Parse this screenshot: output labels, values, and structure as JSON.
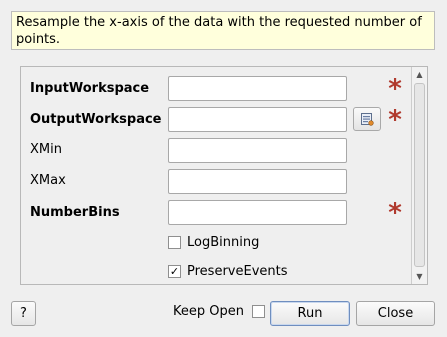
{
  "description": "Resample the x-axis of the data with the requested number of points.",
  "properties": [
    {
      "label": "InputWorkspace",
      "value": "",
      "required": true,
      "bold": true
    },
    {
      "label": "OutputWorkspace",
      "value": "",
      "required": true,
      "bold": true
    },
    {
      "label": "XMin",
      "value": "",
      "required": false,
      "bold": false
    },
    {
      "label": "XMax",
      "value": "",
      "required": false,
      "bold": false
    },
    {
      "label": "NumberBins",
      "value": "",
      "required": true,
      "bold": true
    }
  ],
  "required_marker": "*",
  "checkboxes": [
    {
      "label": "LogBinning",
      "checked": false,
      "check_mark": ""
    },
    {
      "label": "PreserveEvents",
      "checked": true,
      "check_mark": "✓"
    }
  ],
  "footer": {
    "help_label": "?",
    "keep_open_label": "Keep Open",
    "keep_open_checked": false,
    "run_label": "Run",
    "close_label": "Close"
  },
  "icons": {
    "browse": "workspace-browse-icon",
    "scroll_up": "▲",
    "scroll_down": "▼"
  },
  "colors": {
    "description_bg": "#ffffdc",
    "required_star": "#b03a2e"
  }
}
